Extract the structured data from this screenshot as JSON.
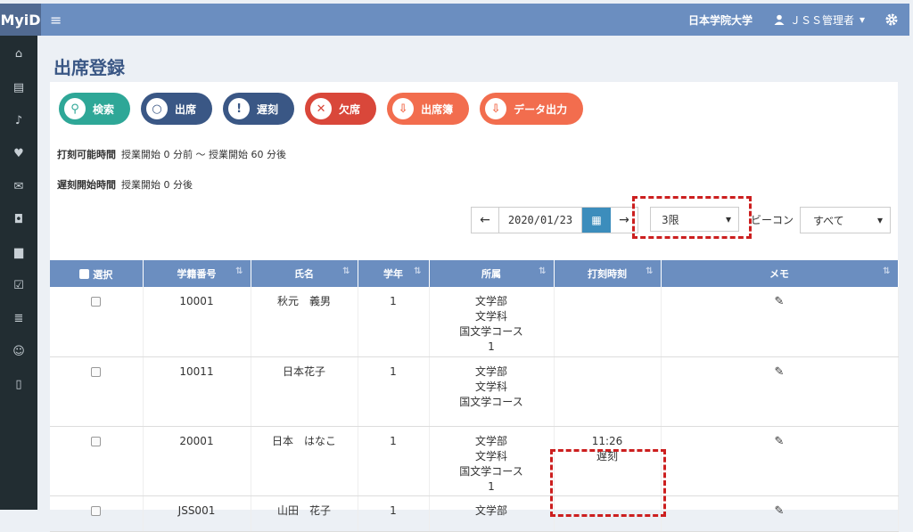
{
  "header": {
    "logo": "MyiD",
    "hamburger": "≡",
    "university": "日本学院大学",
    "user_icon": "user-icon",
    "user": "ＪＳＳ管理者",
    "user_caret": "▾",
    "settings_icon": "gear-icon"
  },
  "sidebar": {
    "items": [
      {
        "icon": "home-icon",
        "glyph": "⌂"
      },
      {
        "icon": "id-card-icon",
        "glyph": "▤"
      },
      {
        "icon": "bell-icon",
        "glyph": "♪"
      },
      {
        "icon": "heartbeat-icon",
        "glyph": "♥"
      },
      {
        "icon": "envelope-icon",
        "glyph": "✉"
      },
      {
        "icon": "train-icon",
        "glyph": "◘"
      },
      {
        "icon": "book-icon",
        "glyph": "▆"
      },
      {
        "icon": "calendar-check-icon",
        "glyph": "☑"
      },
      {
        "icon": "database-icon",
        "glyph": "≣"
      },
      {
        "icon": "user-cog-icon",
        "glyph": "☺"
      },
      {
        "icon": "mobile-icon",
        "glyph": "▯"
      }
    ]
  },
  "page": {
    "title": "出席登録"
  },
  "buttons": {
    "search": {
      "label": "検索",
      "glyph": "⚲",
      "icon": "search-icon"
    },
    "attend": {
      "label": "出席",
      "glyph": "○",
      "icon": "circle-icon"
    },
    "late": {
      "label": "遅刻",
      "glyph": "!",
      "icon": "warning-icon"
    },
    "absent": {
      "label": "欠席",
      "glyph": "✕",
      "icon": "x-icon"
    },
    "book": {
      "label": "出席簿",
      "glyph": "⇩",
      "icon": "cloud-download-icon"
    },
    "export": {
      "label": "データ出力",
      "glyph": "⇩",
      "icon": "cloud-download-icon"
    }
  },
  "info": {
    "stamp_label": "打刻可能時間",
    "stamp_value": "授業開始 0 分前 〜 授業開始 60 分後",
    "late_label": "遅刻開始時間",
    "late_value": "授業開始 0 分後"
  },
  "filters": {
    "prev": "←",
    "date": "2020/01/23",
    "calendar_glyph": "▦",
    "next": "→",
    "period": "3限",
    "caret": "▾",
    "beacon_label": "ビーコン",
    "beacon_value": "すべて"
  },
  "table": {
    "headers": {
      "select": "選択",
      "student_no": "学籍番号",
      "name": "氏名",
      "year": "学年",
      "affiliation": "所属",
      "stamp_time": "打刻時刻",
      "memo": "メモ"
    },
    "sort_glyph": "⇅",
    "edit_glyph": "✎",
    "rows": [
      {
        "id": "10001",
        "name": "秋元　義男",
        "year": "1",
        "aff": [
          "文学部",
          "文学科",
          "国文学コース",
          "1"
        ],
        "time": [
          "",
          ""
        ]
      },
      {
        "id": "10011",
        "name": "日本花子",
        "year": "1",
        "aff": [
          "文学部",
          "文学科",
          "国文学コース",
          ""
        ],
        "time": [
          "",
          ""
        ]
      },
      {
        "id": "20001",
        "name": "日本　はなこ",
        "year": "1",
        "aff": [
          "文学部",
          "文学科",
          "国文学コース",
          "1"
        ],
        "time": [
          "11:26",
          "遅刻"
        ]
      },
      {
        "id": "JSS001",
        "name": "山田　花子",
        "year": "1",
        "aff": [
          "文学部",
          "",
          "",
          ""
        ],
        "time": [
          "",
          ""
        ]
      }
    ]
  }
}
